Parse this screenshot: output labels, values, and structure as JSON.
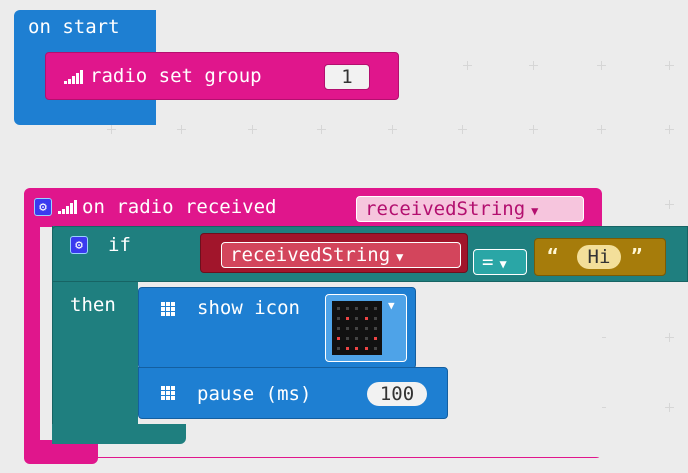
{
  "on_start": {
    "label": "on start"
  },
  "radio_set_group": {
    "label": "radio set group",
    "value": "1"
  },
  "on_radio_received": {
    "label": "on radio received",
    "param": "receivedString"
  },
  "if_block": {
    "if_label": "if",
    "then_label": "then"
  },
  "condition": {
    "left_var": "receivedString",
    "operator": "=",
    "open_quote": "“",
    "string_value": "Hi",
    "close_quote": "”"
  },
  "show_icon": {
    "label": "show icon"
  },
  "pause": {
    "label": "pause (ms)",
    "value": "100"
  },
  "colors": {
    "basic": "#1e7fd2",
    "radio": "#e0168c",
    "logic": "#1f7f7f",
    "variable": "#a1152b",
    "text": "#a67c0b",
    "workspace": "#ececec"
  },
  "icons": {
    "gear": "gear-icon",
    "signal": "signal-bars-icon",
    "grid": "led-grid-icon"
  }
}
